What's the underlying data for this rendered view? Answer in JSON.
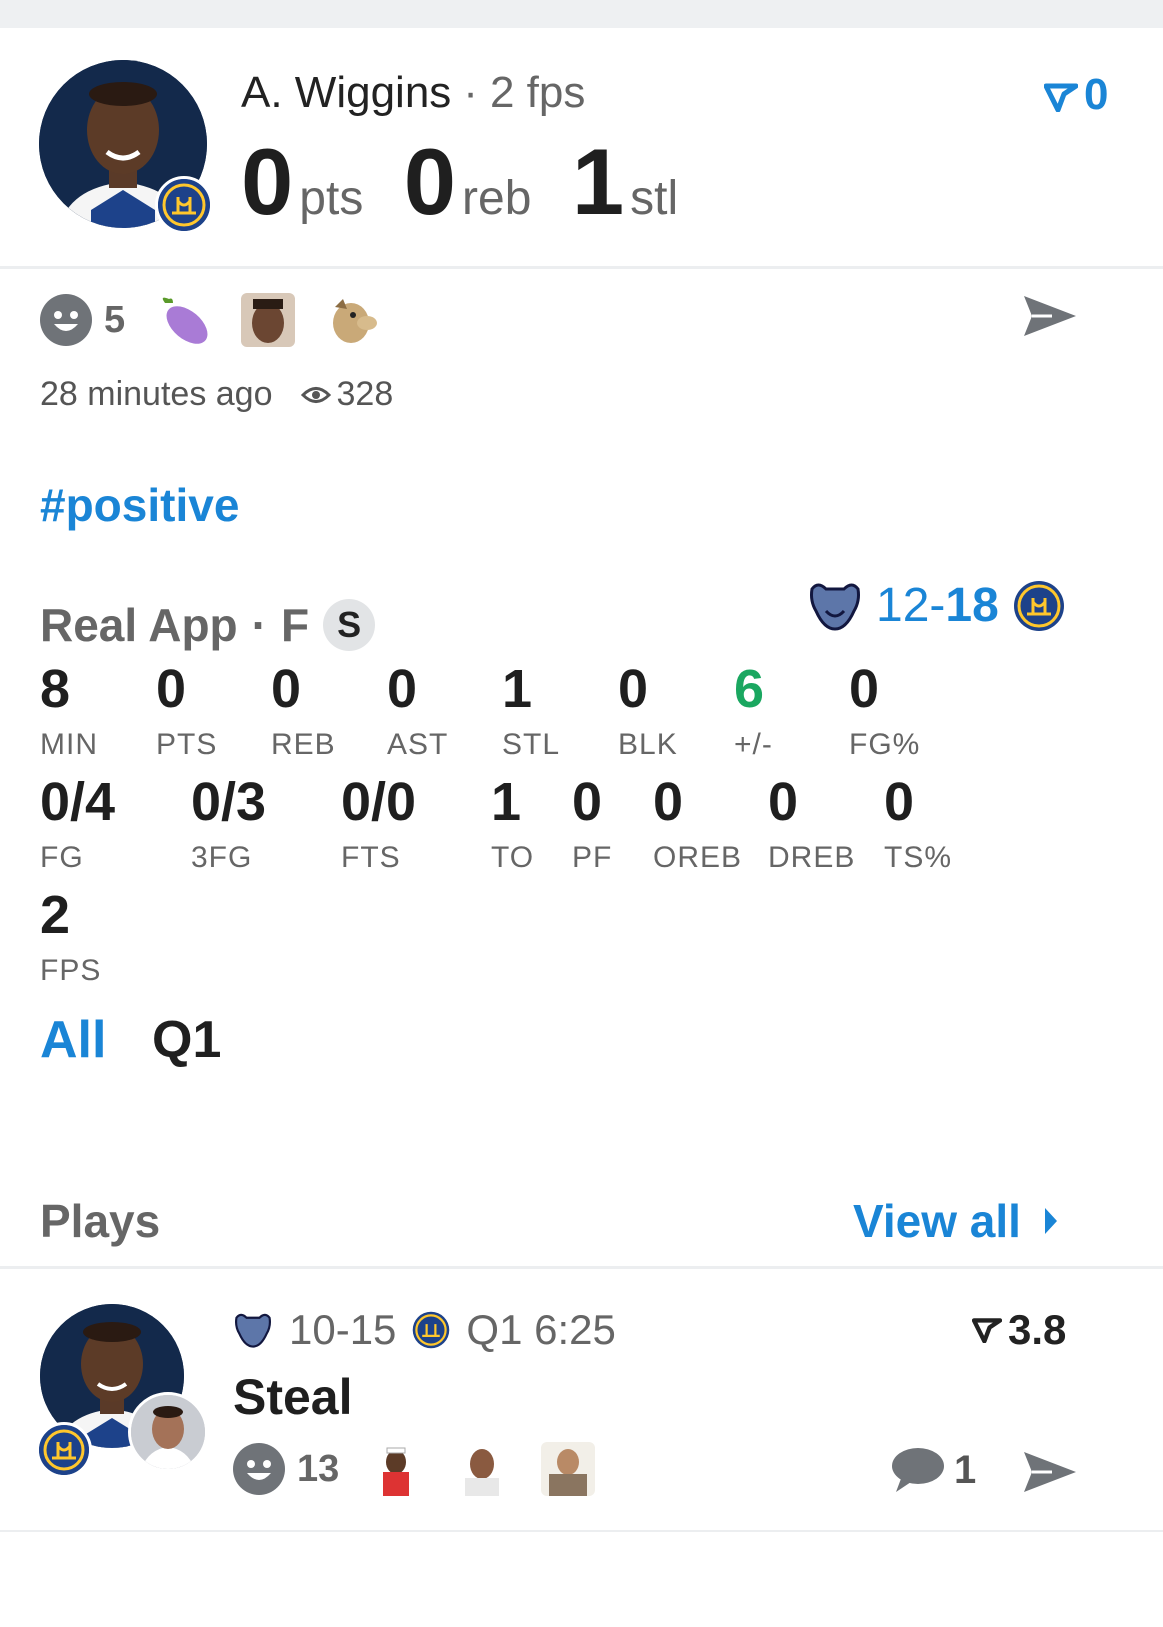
{
  "header": {
    "player_name": "A. Wiggins",
    "separator": "·",
    "fps_label": "2 fps",
    "vote_count": "0",
    "big_stats": [
      {
        "value": "0",
        "unit": "pts"
      },
      {
        "value": "0",
        "unit": "reb"
      },
      {
        "value": "1",
        "unit": "stl"
      }
    ]
  },
  "reactions": {
    "count": "5",
    "time_ago": "28 minutes ago",
    "views": "328",
    "thumbnails": [
      "eggplant-emoji",
      "player-face-reaction",
      "dog-this-is-fine-reaction"
    ]
  },
  "hashtag": "#positive",
  "game": {
    "source": "Real App",
    "separator": "·",
    "position": "F",
    "starter_badge": "S",
    "score_home": "12",
    "score_dash": "-",
    "score_away": "18",
    "home_team_icon": "grizzlies-logo",
    "away_team_icon": "warriors-logo"
  },
  "stats_row1": [
    {
      "value": "8",
      "label": "MIN"
    },
    {
      "value": "0",
      "label": "PTS"
    },
    {
      "value": "0",
      "label": "REB"
    },
    {
      "value": "0",
      "label": "AST"
    },
    {
      "value": "1",
      "label": "STL"
    },
    {
      "value": "0",
      "label": "BLK"
    },
    {
      "value": "6",
      "label": "+/-"
    },
    {
      "value": "0",
      "label": "FG%"
    }
  ],
  "stats_row2": [
    {
      "value": "0/4",
      "label": "FG"
    },
    {
      "value": "0/3",
      "label": "3FG"
    },
    {
      "value": "0/0",
      "label": "FTS"
    },
    {
      "value": "1",
      "label": "TO"
    },
    {
      "value": "0",
      "label": "PF"
    },
    {
      "value": "0",
      "label": "OREB"
    },
    {
      "value": "0",
      "label": "DREB"
    },
    {
      "value": "0",
      "label": "TS%"
    }
  ],
  "stats_row3": [
    {
      "value": "2",
      "label": "FPS"
    }
  ],
  "tabs": [
    {
      "label": "All",
      "active": true
    },
    {
      "label": "Q1",
      "active": false
    }
  ],
  "plays": {
    "title": "Plays",
    "view_all": "View all",
    "items": [
      {
        "score": "10-15",
        "clock": "Q1 6:25",
        "vote": "3.8",
        "title": "Steal",
        "reaction_count": "13",
        "comment_count": "1"
      }
    ]
  },
  "colors": {
    "accent": "#1a85d6",
    "positive": "#1aa760",
    "muted": "#666666"
  }
}
